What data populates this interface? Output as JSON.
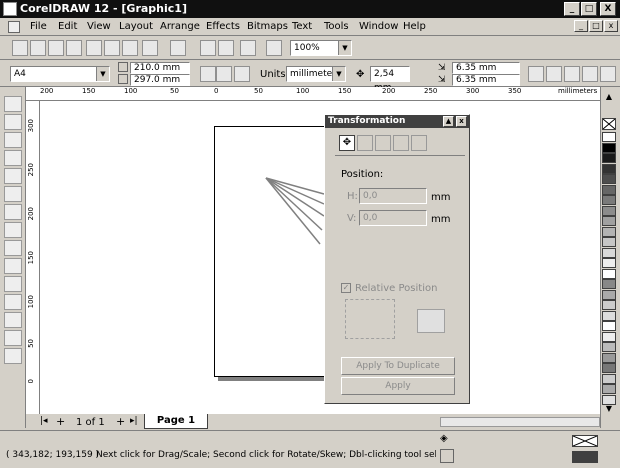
{
  "window": {
    "title": "CorelDRAW 12 - [Graphic1]",
    "min": "_",
    "max": "□",
    "close": "X"
  },
  "menu": [
    "File",
    "Edit",
    "View",
    "Layout",
    "Arrange",
    "Effects",
    "Bitmaps",
    "Text",
    "Tools",
    "Window",
    "Help"
  ],
  "toolbar": {
    "zoom": "100%"
  },
  "propbar": {
    "paper": "A4",
    "width": "210.0 mm",
    "height": "297.0 mm",
    "units_label": "Units:",
    "units": "millimeters",
    "nudge": "2,54 mm",
    "dup_x": "6.35 mm",
    "dup_y": "6.35 mm"
  },
  "ruler": {
    "h_ticks": [
      "200",
      "150",
      "100",
      "50",
      "0",
      "50",
      "100",
      "150",
      "200",
      "250",
      "300",
      "350"
    ],
    "h_unit": "millimeters",
    "v_ticks": [
      "300",
      "250",
      "200",
      "150",
      "100",
      "50",
      "0"
    ],
    "v_unit": "millimeters"
  },
  "docker": {
    "title": "Transformation",
    "position_label": "Position:",
    "h_label": "H:",
    "h_value": "0,0",
    "v_label": "V:",
    "v_value": "0,0",
    "unit": "mm",
    "relative_label": "Relative Position",
    "apply_dup": "Apply To Duplicate",
    "apply": "Apply"
  },
  "pages": {
    "counter": "1 of 1",
    "tab": "Page 1"
  },
  "status": {
    "coords": "( 343,182; 193,159 )",
    "hint": "Next click for Drag/Scale; Second click for Rotate/Skew; Dbl-clicking tool selects all objec..."
  },
  "palette_colors": [
    "#ffffff",
    "#000000",
    "#1a1a1a",
    "#333333",
    "#4d4d4d",
    "#666666",
    "#7a7a7a",
    "#8c8c8c",
    "#a0a0a0",
    "#b3b3b3",
    "#c6c6c6",
    "#d9d9d9",
    "#eeeeee",
    "#ffffff",
    "#888888",
    "#aaaaaa",
    "#cccccc",
    "#dddddd",
    "#ffffff",
    "#eeeeee",
    "#bbbbbb",
    "#999999",
    "#777777",
    "#cccccc",
    "#aaaaaa",
    "#e0e0e0"
  ]
}
